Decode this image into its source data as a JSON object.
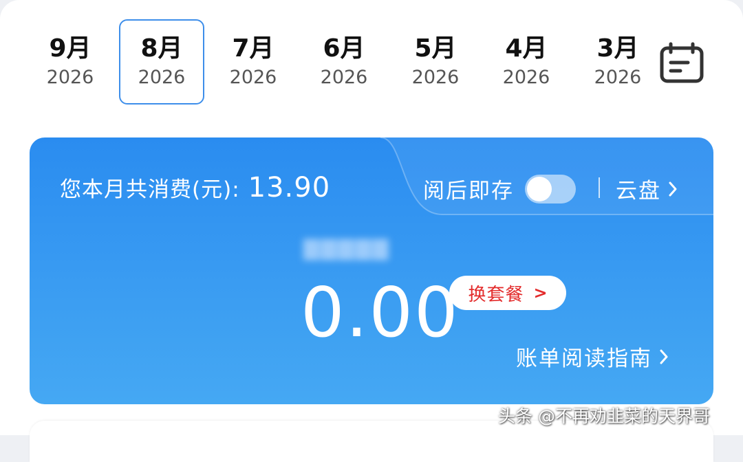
{
  "months": [
    {
      "month": "9月",
      "year": "2026",
      "active": false
    },
    {
      "month": "8月",
      "year": "2026",
      "active": true
    },
    {
      "month": "7月",
      "year": "2026",
      "active": false
    },
    {
      "month": "6月",
      "year": "2026",
      "active": false
    },
    {
      "month": "5月",
      "year": "2026",
      "active": false
    },
    {
      "month": "4月",
      "year": "2026",
      "active": false
    },
    {
      "month": "3月",
      "year": "2026",
      "active": false
    }
  ],
  "calendar_icon": "calendar-icon",
  "bill": {
    "spend_label": "您本月共消费(元):",
    "spend_value": "13.90",
    "read_save_label": "阅后即存",
    "read_save_on": false,
    "cloud_label": "云盘",
    "amount": "0.00",
    "change_plan_label": "换套餐",
    "change_plan_arrow": ">",
    "guide_label": "账单阅读指南"
  },
  "watermark": "头条 @不再劝韭菜的天界哥",
  "colors": {
    "accent": "#3d8eea",
    "card_top": "#2a8cf0",
    "card_bottom": "#45a8f3",
    "plan_text": "#e32c2c"
  }
}
